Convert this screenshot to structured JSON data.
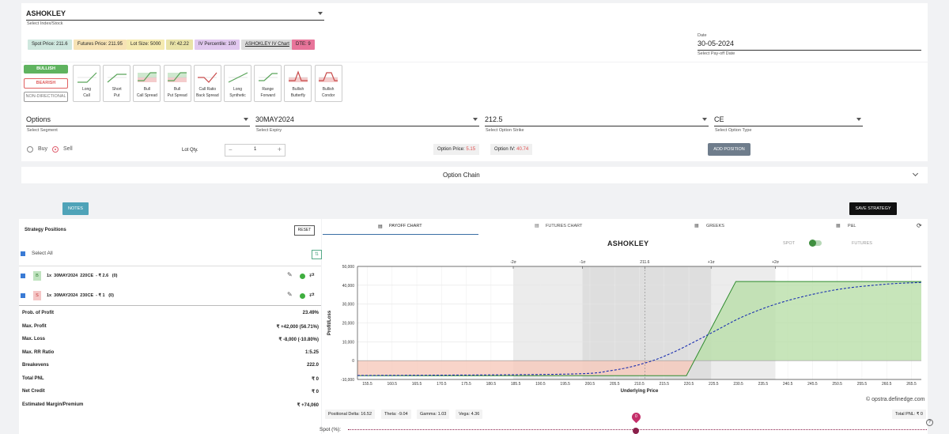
{
  "header": {
    "symbol": "ASHOKLEY",
    "symbol_hint": "Select Index/Stock",
    "date_label": "Date",
    "date_value": "30-05-2024",
    "date_hint": "Select Pay-off Date"
  },
  "chips": {
    "spot": "Spot Price: 211.6",
    "futures": "Futures Price: 211.95",
    "lot": "Lot Size: 5000",
    "iv": "IV: 42.22",
    "ivp": "IV Percentile: 100",
    "ivchart": "ASHOKLEY IV Chart",
    "dte": "DTE: 9"
  },
  "direction": {
    "bullish": "BULLISH",
    "bearish": "BEARISH",
    "neutral": "NON-DIRECTIONAL"
  },
  "strategies": [
    {
      "l1": "Long",
      "l2": "Call"
    },
    {
      "l1": "Short",
      "l2": "Put"
    },
    {
      "l1": "Bull",
      "l2": "Call Spread"
    },
    {
      "l1": "Bull",
      "l2": "Put Spread"
    },
    {
      "l1": "Call Ratio",
      "l2": "Back Spread"
    },
    {
      "l1": "Long",
      "l2": "Synthetic"
    },
    {
      "l1": "Range",
      "l2": "Forward"
    },
    {
      "l1": "Bullish",
      "l2": "Butterfly"
    },
    {
      "l1": "Bullish",
      "l2": "Condor"
    }
  ],
  "form": {
    "segment": "Options",
    "segment_hint": "Select Segment",
    "expiry": "30MAY2024",
    "expiry_hint": "Select Expiry",
    "strike": "212.5",
    "strike_hint": "Select Option Strike",
    "type": "CE",
    "type_hint": "Select Option Type",
    "buy": "Buy",
    "sell": "Sell",
    "lot_qty_label": "Lot Qty.",
    "lot_qty": "1",
    "option_price_label": "Option Price:",
    "option_price": "5.15",
    "option_iv_label": "Option IV:",
    "option_iv": "40.74",
    "add_position": "ADD POSITION"
  },
  "option_chain": "Option Chain",
  "notes": "NOTES",
  "save_strategy": "SAVE STRATEGY",
  "positions": {
    "title": "Strategy Positions",
    "reset": "RESET",
    "select_all": "Select All",
    "rows": [
      {
        "side": "B",
        "text": "1x  30MAY2024  220CE  - ₹ 2.6   (0)"
      },
      {
        "side": "S",
        "text": "1x  30MAY2024  230CE  - ₹ 1   (0)"
      }
    ]
  },
  "stats": [
    {
      "label": "Prob. of Profit",
      "value": "23.49%"
    },
    {
      "label": "Max. Profit",
      "value": "₹ +42,000 (56.71%)"
    },
    {
      "label": "Max. Loss",
      "value": "₹ -8,000 (-10.80%)"
    },
    {
      "label": "Max. RR Ratio",
      "value": "1:5.25"
    },
    {
      "label": "Breakevens",
      "value": "222.0"
    },
    {
      "label": "Total PNL",
      "value": "₹ 0"
    },
    {
      "label": "Net Credit",
      "value": "₹ 0"
    },
    {
      "label": "Estimated Margin/Premium",
      "value": "₹ +74,060"
    }
  ],
  "tabs": {
    "payoff": "PAYOFF CHART",
    "futures": "FUTURES CHART",
    "greeks": "GREEKS",
    "pnl": "P&L"
  },
  "chart_meta": {
    "spot_label": "SPOT",
    "futures_label": "FUTURES",
    "credit": "© opstra.definedge.com"
  },
  "greeks": {
    "delta": "Positional Delta: 16.52",
    "theta": "Theta: -9.04",
    "gamma": "Gamma: 1.03",
    "vega": "Vega: 4.36",
    "total_pnl": "Total PNL: ₹ 0"
  },
  "slider": {
    "label": "Spot (%):",
    "marker": "0"
  },
  "chart_data": {
    "type": "line",
    "title": "ASHOKLEY",
    "xlabel": "Underlying Price",
    "ylabel": "Profit/Loss",
    "xlim": [
      153.5,
      267.5
    ],
    "ylim": [
      -10000,
      50000
    ],
    "x_ticks": [
      "155.5",
      "160.5",
      "165.5",
      "170.5",
      "175.5",
      "180.5",
      "185.5",
      "190.5",
      "195.5",
      "200.5",
      "205.5",
      "210.5",
      "215.5",
      "220.5",
      "225.5",
      "230.5",
      "235.5",
      "240.5",
      "245.5",
      "250.5",
      "255.5",
      "260.5",
      "265.5"
    ],
    "y_ticks": [
      "50,000",
      "40,000",
      "30,000",
      "20,000",
      "10,000",
      "0",
      "-10,000"
    ],
    "top_ticks": [
      {
        "label": "-2σ",
        "x": 185.0
      },
      {
        "label": "-1σ",
        "x": 199.0
      },
      {
        "label": "211.6",
        "x": 211.6
      },
      {
        "label": "+1σ",
        "x": 225.0
      },
      {
        "label": "+2σ",
        "x": 238.0
      }
    ],
    "series": [
      {
        "name": "expiry",
        "color": "#2e8b2e",
        "x": [
          153.5,
          220.0,
          230.0,
          267.5
        ],
        "y": [
          -8000,
          -8000,
          42000,
          42000
        ]
      },
      {
        "name": "target",
        "color": "#1a2fb0",
        "x": [
          153.5,
          195,
          205,
          212,
          217,
          222,
          226,
          232,
          240,
          250,
          260,
          267.5
        ],
        "y": [
          -7900,
          -7200,
          -5200,
          -1000,
          4000,
          10500,
          16000,
          24000,
          31500,
          37500,
          40500,
          41500
        ]
      }
    ]
  }
}
